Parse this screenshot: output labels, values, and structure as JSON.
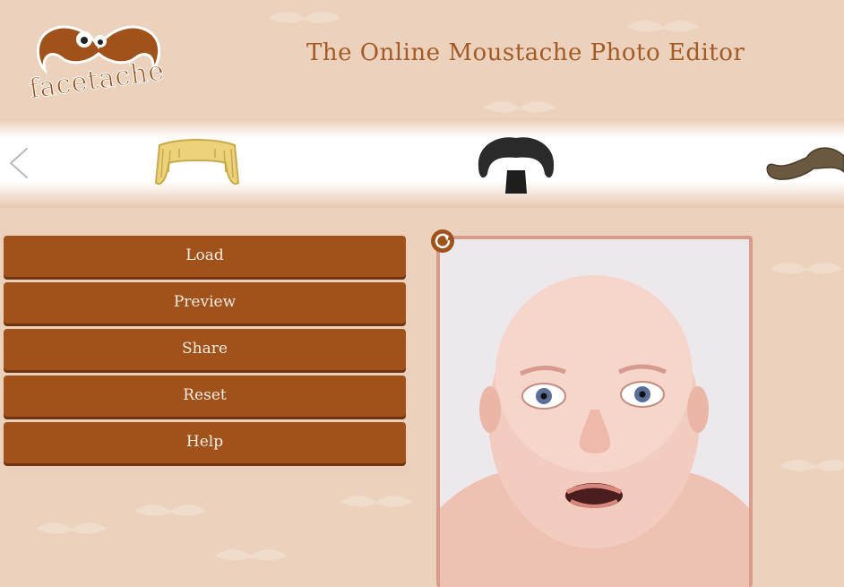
{
  "header": {
    "logo_text": "facetache",
    "title": "The Online Moustache Photo Editor"
  },
  "carousel": {
    "items": [
      {
        "name": "blonde-walrus-moustache",
        "color": "#ecd27a"
      },
      {
        "name": "black-moustache-goatee",
        "color": "#2a2a2a"
      },
      {
        "name": "brown-curly-moustache",
        "color": "#6b5840"
      }
    ]
  },
  "menu": {
    "load": "Load",
    "preview": "Preview",
    "share": "Share",
    "reset": "Reset",
    "help": "Help"
  },
  "colors": {
    "accent": "#a0521a",
    "background": "#ecd2bd",
    "title": "#a45a24"
  }
}
